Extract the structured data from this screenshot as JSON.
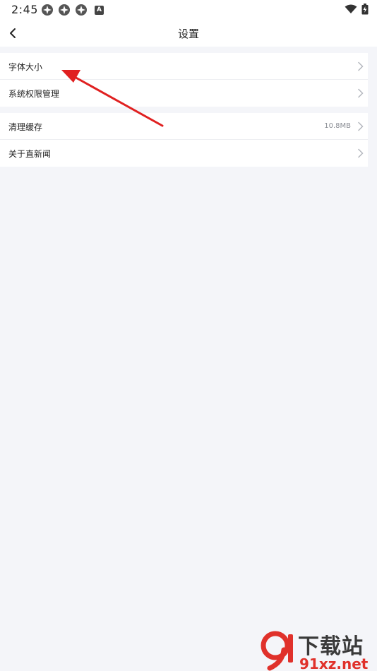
{
  "status_bar": {
    "time": "2:45",
    "left_icons": [
      "app-notification-icon",
      "app-notification-icon",
      "app-notification-icon",
      "a-badge-icon"
    ],
    "a_badge": "A",
    "right_icons": [
      "wifi-icon",
      "battery-charging-icon"
    ]
  },
  "nav": {
    "title": "设置",
    "back_icon": "chevron-left-icon"
  },
  "settings": {
    "group1": [
      {
        "label": "字体大小",
        "value": ""
      },
      {
        "label": "系统权限管理",
        "value": ""
      }
    ],
    "group2": [
      {
        "label": "清理缓存",
        "value": "10.8MB"
      },
      {
        "label": "关于直新闻",
        "value": ""
      }
    ]
  },
  "watermark": {
    "title": "下载站",
    "url": "91xz.net"
  },
  "colors": {
    "background": "#f4f5f9",
    "card": "#ffffff",
    "annotation_red": "#e02020",
    "watermark_red": "#e0312b"
  }
}
